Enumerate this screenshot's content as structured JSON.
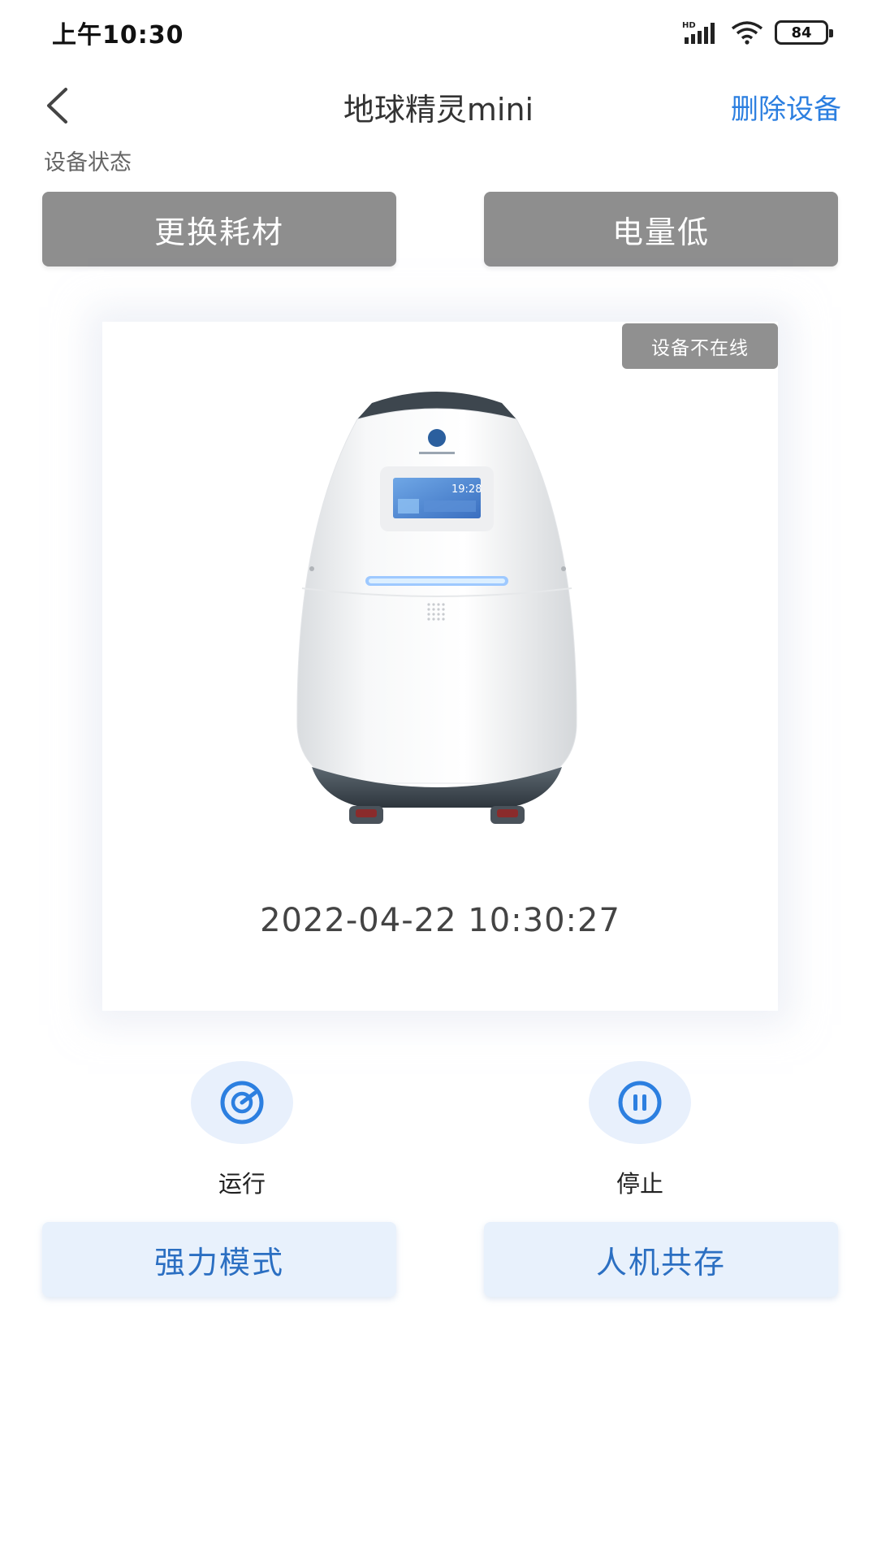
{
  "status_bar": {
    "time": "上午10:30",
    "battery": "84",
    "icons": [
      "hd-signal-icon",
      "wifi-icon",
      "battery-icon"
    ]
  },
  "nav": {
    "back_icon": "chevron-left-icon",
    "title": "地球精灵mini",
    "delete_label": "删除设备"
  },
  "device_status": {
    "label": "设备状态",
    "buttons": [
      "更换耗材",
      "电量低"
    ]
  },
  "card": {
    "offline_badge": "设备不在线",
    "screen_time": "19:28",
    "timestamp": "2022-04-22 10:30:27"
  },
  "controls": [
    {
      "label": "运行",
      "icon": "gauge-icon"
    },
    {
      "label": "停止",
      "icon": "pause-icon"
    }
  ],
  "modes": [
    "强力模式",
    "人机共存"
  ],
  "colors": {
    "accent": "#2c7fe0",
    "status_button_bg": "#8e8e8e",
    "mode_button_bg": "#e8f1fc",
    "control_circle_bg": "#e8f0fc"
  }
}
